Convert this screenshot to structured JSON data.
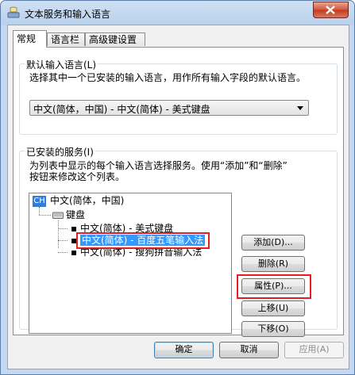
{
  "window": {
    "title": "文本服务和输入语言",
    "close_glyph": "✕"
  },
  "tabs": [
    {
      "label": "常规",
      "active": true
    },
    {
      "label": "语言栏",
      "active": false
    },
    {
      "label": "高级键设置",
      "active": false
    }
  ],
  "default_input": {
    "group_title": "默认输入语言(L)",
    "description": "选择其中一个已安装的输入语言，用作所有输入字段的默认语言。",
    "selected": "中文(简体，中国) - 中文(简体) - 美式键盘"
  },
  "installed": {
    "group_title": "已安装的服务(I)",
    "description_line1": "为列表中显示的每个输入语言选择服务。使用“添加”和“删除”",
    "description_line2": "按钮来修改这个列表。",
    "lang_badge": "CH",
    "language": "中文(简体，中国)",
    "category": "键盘",
    "items": [
      {
        "label": "中文(简体) - 美式键盘",
        "selected": false
      },
      {
        "label": "中文(简体) - 百度五笔输入法",
        "selected": true
      },
      {
        "label": "中文(简体) - 搜狗拼音输入法",
        "selected": false
      }
    ],
    "buttons": {
      "add": "添加(D)...",
      "remove": "删除(R)",
      "properties": "属性(P)...",
      "move_up": "上移(U)",
      "move_down": "下移(O)"
    }
  },
  "footer": {
    "ok": "确定",
    "cancel": "取消",
    "apply": "应用(A)"
  },
  "colors": {
    "accent_blue": "#3399ff",
    "highlight_red": "#e02020",
    "lang_badge": "#2f7fd8"
  }
}
